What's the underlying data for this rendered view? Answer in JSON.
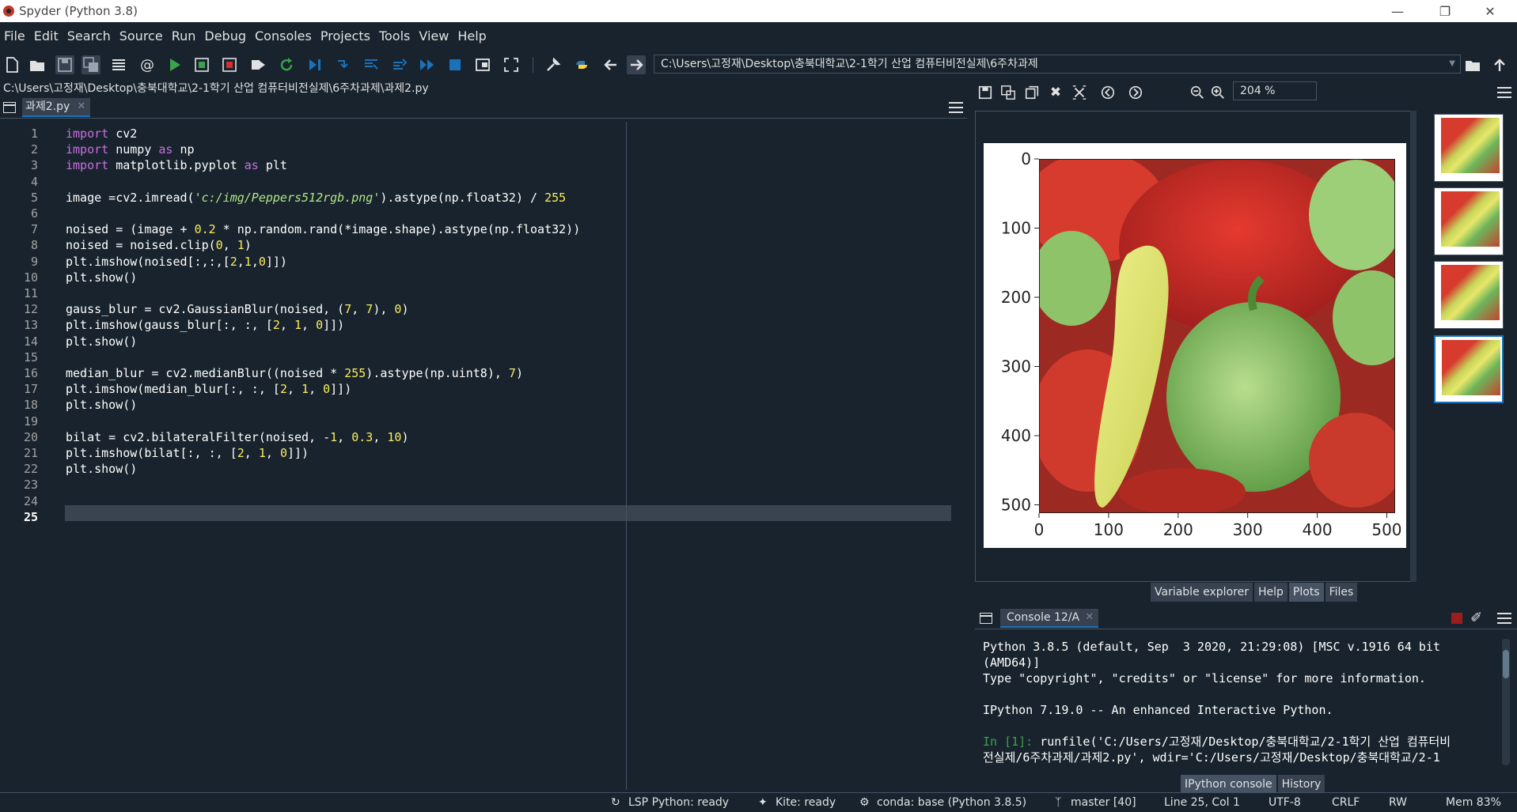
{
  "window": {
    "title": "Spyder (Python 3.8)"
  },
  "menubar": {
    "items": [
      "File",
      "Edit",
      "Search",
      "Source",
      "Run",
      "Debug",
      "Consoles",
      "Projects",
      "Tools",
      "View",
      "Help"
    ]
  },
  "toolbar": {
    "working_dir": "C:\\Users\\고정재\\Desktop\\충북대학교\\2-1학기 산업 컴퓨터비전실제\\6주차과제"
  },
  "editor": {
    "file_path": "C:\\Users\\고정재\\Desktop\\충북대학교\\2-1학기 산업 컴퓨터비전실제\\6주차과제\\과제2.py",
    "tab_label": "과제2.py",
    "current_line": 25,
    "lines": [
      "import cv2",
      "import numpy as np",
      "import matplotlib.pyplot as plt",
      "",
      "image =cv2.imread('c:/img/Peppers512rgb.png').astype(np.float32) / 255",
      "",
      "noised = (image + 0.2 * np.random.rand(*image.shape).astype(np.float32))",
      "noised = noised.clip(0, 1)",
      "plt.imshow(noised[:,:,[2,1,0]])",
      "plt.show()",
      "",
      "gauss_blur = cv2.GaussianBlur(noised, (7, 7), 0)",
      "plt.imshow(gauss_blur[:, :, [2, 1, 0]])",
      "plt.show()",
      "",
      "median_blur = cv2.medianBlur((noised * 255).astype(np.uint8), 7)",
      "plt.imshow(median_blur[:, :, [2, 1, 0]])",
      "plt.show()",
      "",
      "bilat = cv2.bilateralFilter(noised, -1, 0.3, 10)",
      "plt.imshow(bilat[:, :, [2, 1, 0]])",
      "plt.show()",
      "",
      "",
      ""
    ]
  },
  "plots": {
    "zoom": "204 %",
    "thumbnail_count": 4,
    "selected_thumbnail": 4,
    "x_ticks": [
      "0",
      "100",
      "200",
      "300",
      "400",
      "500"
    ],
    "y_ticks": [
      "0",
      "100",
      "200",
      "300",
      "400",
      "500"
    ]
  },
  "right_tabs": [
    "Variable explorer",
    "Help",
    "Plots",
    "Files"
  ],
  "right_tabs_active": "Plots",
  "console": {
    "tab_label": "Console 12/A",
    "text_1": "Python 3.8.5 (default, Sep  3 2020, 21:29:08) [MSC v.1916 64 bit\n(AMD64)]\nType \"copyright\", \"credits\" or \"license\" for more information.\n\nIPython 7.19.0 -- An enhanced Interactive Python.\n\n",
    "prompt": "In [1]: ",
    "command": "runfile('C:/Users/고정재/Desktop/충북대학교/2-1학기 산업 컴퓨터비\n전실제/6주차과제/과제2.py', wdir='C:/Users/고정재/Desktop/충북대학교/2-1",
    "bottom_tabs": [
      "IPython console",
      "History"
    ]
  },
  "statusbar": {
    "lsp": "LSP Python: ready",
    "kite": "Kite: ready",
    "conda": "conda: base (Python 3.8.5)",
    "git": "master [40]",
    "position": "Line 25, Col 1",
    "encoding": "UTF-8",
    "eol": "CRLF",
    "permissions": "RW",
    "memory": "Mem 83%"
  },
  "colors": {
    "bg": "#19232d",
    "accent": "#1a72bb",
    "keyword": "#c670e0",
    "number": "#faed5c",
    "string": "#b0e686"
  }
}
